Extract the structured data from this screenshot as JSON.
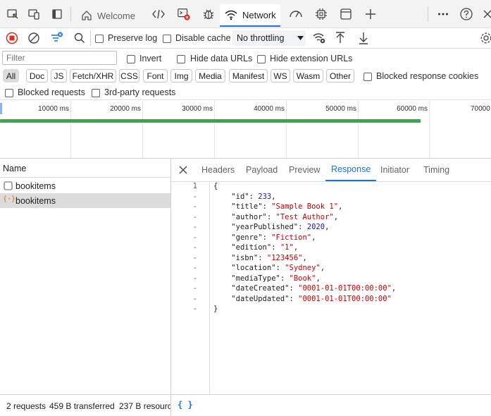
{
  "tabs": {
    "welcome": "Welcome",
    "network": "Network"
  },
  "toolbar": {
    "preserve_log": "Preserve log",
    "disable_cache": "Disable cache",
    "throttling": "No throttling"
  },
  "filter": {
    "placeholder": "Filter",
    "invert": "Invert",
    "hide_data_urls": "Hide data URLs",
    "hide_extension_urls": "Hide extension URLs",
    "types": [
      "All",
      "Doc",
      "JS",
      "Fetch/XHR",
      "CSS",
      "Font",
      "Img",
      "Media",
      "Manifest",
      "WS",
      "Wasm",
      "Other"
    ],
    "blocked_response_cookies": "Blocked response cookies",
    "blocked_requests": "Blocked requests",
    "third_party_requests": "3rd-party requests"
  },
  "timeline": {
    "ticks": [
      "10000 ms",
      "20000 ms",
      "30000 ms",
      "40000 ms",
      "50000 ms",
      "60000 ms",
      "70000"
    ]
  },
  "requests": {
    "header": "Name",
    "rows": [
      {
        "name": "bookitems",
        "icon": "document-icon"
      },
      {
        "name": "bookitems",
        "icon": "json-icon"
      }
    ]
  },
  "details": {
    "tabs": [
      "Headers",
      "Payload",
      "Preview",
      "Response",
      "Initiator",
      "Timing"
    ],
    "active_tab": "Response",
    "line_markers": [
      "1",
      "-",
      "-",
      "-",
      "-",
      "-",
      "-",
      "-",
      "-",
      "-",
      "-",
      "-",
      "-"
    ],
    "response": {
      "open": "{",
      "close": "}",
      "fields": [
        {
          "key": "\"id\"",
          "value": "233",
          "kind": "n",
          "comma": ","
        },
        {
          "key": "\"title\"",
          "value": "\"Sample Book 1\"",
          "kind": "s",
          "comma": ","
        },
        {
          "key": "\"author\"",
          "value": "\"Test Author\"",
          "kind": "s",
          "comma": ","
        },
        {
          "key": "\"yearPublished\"",
          "value": "2020",
          "kind": "n",
          "comma": ","
        },
        {
          "key": "\"genre\"",
          "value": "\"Fiction\"",
          "kind": "s",
          "comma": ","
        },
        {
          "key": "\"edition\"",
          "value": "\"1\"",
          "kind": "s",
          "comma": ","
        },
        {
          "key": "\"isbn\"",
          "value": "\"123456\"",
          "kind": "s",
          "comma": ","
        },
        {
          "key": "\"location\"",
          "value": "\"Sydney\"",
          "kind": "s",
          "comma": ","
        },
        {
          "key": "\"mediaType\"",
          "value": "\"Book\"",
          "kind": "s",
          "comma": ","
        },
        {
          "key": "\"dateCreated\"",
          "value": "\"0001-01-01T00:00:00\"",
          "kind": "s",
          "comma": ","
        },
        {
          "key": "\"dateUpdated\"",
          "value": "\"0001-01-01T00:00:00\"",
          "kind": "s",
          "comma": ""
        }
      ]
    }
  },
  "status": {
    "requests": "2 requests",
    "transferred": "459 B transferred",
    "resources": "237 B resourc",
    "pretty_print": "{ }"
  },
  "colors": {
    "accent": "#1a73e8",
    "record": "#d93025",
    "timeline_bar": "#34a853",
    "string": "#c80000",
    "number": "#1a1aa6"
  }
}
